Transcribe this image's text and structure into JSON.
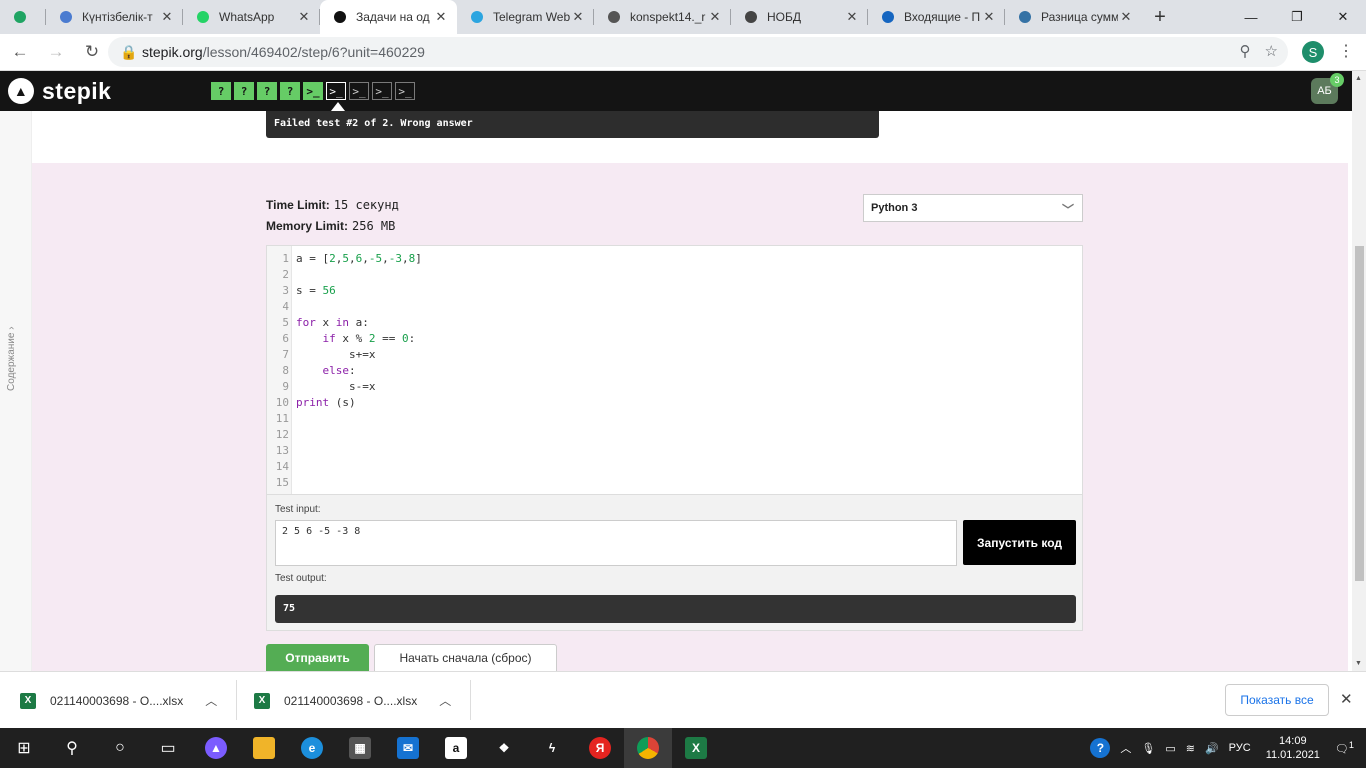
{
  "browser": {
    "tabs": [
      {
        "title": "",
        "icon": "drive-icon",
        "color": "#1fa463",
        "active": false
      },
      {
        "title": "Күнтізбелік-т",
        "icon": "quill-icon",
        "color": "#4a7bd0",
        "active": false
      },
      {
        "title": "WhatsApp",
        "icon": "whatsapp-icon",
        "color": "#25d366",
        "active": false
      },
      {
        "title": "Задачи на од",
        "icon": "stepik-icon",
        "color": "#111111",
        "active": true
      },
      {
        "title": "Telegram Web",
        "icon": "telegram-icon",
        "color": "#2ca5e0",
        "active": false
      },
      {
        "title": "konspekt14._r",
        "icon": "globe-icon",
        "color": "#555555",
        "active": false
      },
      {
        "title": "НОБД",
        "icon": "emblem-icon",
        "color": "#444444",
        "active": false
      },
      {
        "title": "Входящие - П",
        "icon": "mail-icon",
        "color": "#1565c0",
        "active": false
      },
      {
        "title": "Разница сумм",
        "icon": "python-icon",
        "color": "#3572a5",
        "active": false
      }
    ],
    "url_host": "stepik.org",
    "url_path": "/lesson/469402/step/6?unit=460229",
    "profile_initial": "S"
  },
  "stepik": {
    "logo_text": "stepik",
    "steps": [
      {
        "glyph": "?",
        "state": "passed"
      },
      {
        "glyph": "?",
        "state": "passed"
      },
      {
        "glyph": "?",
        "state": "passed"
      },
      {
        "glyph": "?",
        "state": "passed"
      },
      {
        "glyph": ">_",
        "state": "passed"
      },
      {
        "glyph": ">_",
        "state": "current"
      },
      {
        "glyph": ">_",
        "state": "normal"
      },
      {
        "glyph": ">_",
        "state": "normal"
      },
      {
        "glyph": ">_",
        "state": "normal"
      }
    ],
    "avatar_initials": "АБ",
    "notification_count": "3"
  },
  "page": {
    "sidebar_toc": "Содержание",
    "failed_message": "Failed test #2 of 2. Wrong answer",
    "time_limit_label": "Time Limit:",
    "time_limit_value": "15 секунд",
    "memory_limit_label": "Memory Limit:",
    "memory_limit_value": "256 MB",
    "language": "Python 3",
    "code_lines": [
      "a = [2,5,6,-5,-3,8]",
      "",
      "s = 56",
      "",
      "for x in a:",
      "    if x % 2 == 0:",
      "        s+=x",
      "    else:",
      "        s-=x",
      "print (s)",
      "",
      "",
      "",
      "",
      ""
    ],
    "test_input_label": "Test input:",
    "test_input_value": "2 5 6 -5 -3 8",
    "run_button": "Запустить код",
    "test_output_label": "Test output:",
    "test_output_value": "75",
    "submit_button": "Отправить",
    "reset_button": "Начать сначала (сброс)"
  },
  "downloads": {
    "items": [
      {
        "name": "021140003698 - О....xlsx"
      },
      {
        "name": "021140003698 - О....xlsx"
      }
    ],
    "show_all": "Показать все"
  },
  "taskbar": {
    "lang": "РУС",
    "time": "14:09",
    "date": "11.01.2021",
    "notification_count": "1"
  }
}
